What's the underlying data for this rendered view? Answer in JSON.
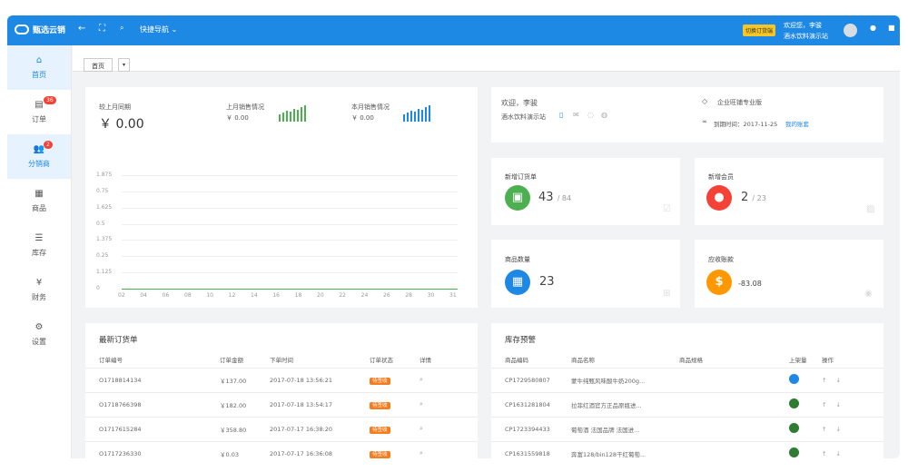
{
  "app": {
    "name": "甄选云销"
  },
  "topbar": {
    "quick_nav": "快捷导航",
    "switch_label": "切换订货端",
    "welcome_line1": "欢迎您，李骏",
    "welcome_line2": "酒水饮料演示站"
  },
  "sidebar": {
    "items": [
      {
        "label": "首页",
        "icon": "home-icon",
        "badge": ""
      },
      {
        "label": "订单",
        "icon": "order-icon",
        "badge": "36"
      },
      {
        "label": "分销商",
        "icon": "distributor-icon",
        "badge": "2"
      },
      {
        "label": "商品",
        "icon": "goods-icon",
        "badge": ""
      },
      {
        "label": "库存",
        "icon": "list-icon",
        "badge": ""
      },
      {
        "label": "财务",
        "icon": "yen-icon",
        "badge": ""
      },
      {
        "label": "设置",
        "icon": "gear-icon",
        "badge": ""
      }
    ]
  },
  "tabs": {
    "home": "首页"
  },
  "sales": {
    "yoy_label": "较上月同期",
    "yoy_value": "￥ 0.00",
    "last_month_label": "上月销售情况",
    "last_month_value": "￥ 0.00",
    "this_month_label": "本月销售情况",
    "this_month_value": "￥ 0.00"
  },
  "chart_data": {
    "type": "line",
    "x": [
      "02",
      "04",
      "06",
      "08",
      "10",
      "12",
      "14",
      "16",
      "18",
      "20",
      "22",
      "24",
      "26",
      "28",
      "30",
      "31"
    ],
    "y_ticks": [
      "1.875",
      "0.75",
      "1.625",
      "0.5",
      "1.375",
      "0.25",
      "1.125",
      "0"
    ],
    "series": [
      {
        "values": [
          0,
          0,
          0,
          0,
          0,
          0,
          0,
          0,
          0,
          0,
          0,
          0,
          0,
          0,
          0,
          0
        ],
        "color": "#4caf50"
      }
    ],
    "ylim": [
      0,
      1.875
    ]
  },
  "profile": {
    "greeting": "欢迎，李骏",
    "store": "酒水饮料演示站",
    "edition": "企业旺铺专业版",
    "expiry_label": "到期时间：2017-11-25",
    "account_link": "我的账套"
  },
  "stats": {
    "new_orders": {
      "title": "新增订货单",
      "value": "43",
      "total": "/ 84",
      "color": "#4caf50"
    },
    "new_members": {
      "title": "新增会员",
      "value": "2",
      "total": "/ 23",
      "color": "#f44336"
    },
    "goods_count": {
      "title": "商品数量",
      "value": "23",
      "color": "#1e88e5"
    },
    "receivable": {
      "title": "应收账款",
      "value": "-83.08",
      "color": "#ff9800"
    }
  },
  "orders": {
    "title": "最新订货单",
    "columns": [
      "订单编号",
      "订单金额",
      "下单时间",
      "订单状态",
      "详情"
    ],
    "rows": [
      {
        "id": "O1718814134",
        "amount": "￥137.00",
        "time": "2017-07-18 13:56:21",
        "status": "待签收"
      },
      {
        "id": "O1718766398",
        "amount": "￥182.00",
        "time": "2017-07-18 13:54:17",
        "status": "待签收"
      },
      {
        "id": "O1717615284",
        "amount": "￥358.80",
        "time": "2017-07-17 16:38:20",
        "status": "待签收"
      },
      {
        "id": "O1717236330",
        "amount": "￥0.03",
        "time": "2017-07-17 16:36:08",
        "status": "待签收"
      }
    ]
  },
  "stock": {
    "title": "库存预警",
    "columns": [
      "商品编码",
      "商品名称",
      "商品规格",
      "上架量",
      "操作"
    ],
    "rows": [
      {
        "code": "CP1729580807",
        "name": "蒙牛纯甄风味酸牛奶200g...",
        "spec": "",
        "pie_color": "#1e88e5"
      },
      {
        "code": "CP1631281804",
        "name": "拉菲红酒官方正品原瓶进...",
        "spec": "",
        "pie_color": "#2e7d32"
      },
      {
        "code": "CP1723394433",
        "name": "葡萄酒 法国品牌 法国进...",
        "spec": "",
        "pie_color": "#2e7d32"
      },
      {
        "code": "CP1631559818",
        "name": "奔富128/bin128干红葡萄...",
        "spec": "",
        "pie_color": "#2e7d32"
      }
    ]
  }
}
